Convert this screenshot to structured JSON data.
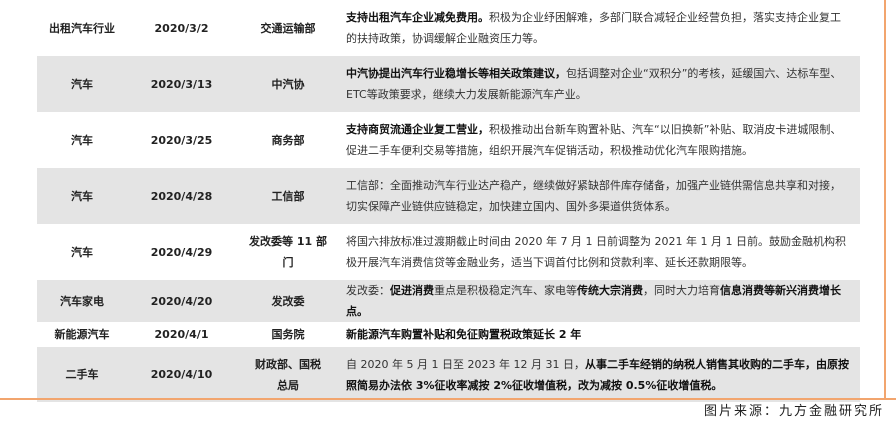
{
  "rows": [
    {
      "industry": "出租汽车行业",
      "date": "2020/3/2",
      "dept": "交通运输部",
      "bold": "支持出租汽车企业减免费用。",
      "rest": "积极为企业纾困解难，多部门联合减轻企业经营负担，落实支持企业复工的扶持政策，协调缓解企业融资压力等。"
    },
    {
      "industry": "汽车",
      "date": "2020/3/13",
      "dept": "中汽协",
      "bold": "中汽协提出汽车行业稳增长等相关政策建议，",
      "rest": "包括调整对企业“双积分”的考核，延缓国六、达标车型、ETC等政策要求，继续大力发展新能源汽车产业。"
    },
    {
      "industry": "汽车",
      "date": "2020/3/25",
      "dept": "商务部",
      "bold": "支持商贸流通企业复工营业，",
      "rest": "积极推动出台新车购置补贴、汽车“以旧换新”补贴、取消皮卡进城限制、促进二手车便利交易等措施，组织开展汽车促销活动，积极推动优化汽车限购措施。"
    },
    {
      "industry": "汽车",
      "date": "2020/4/28",
      "dept": "工信部",
      "bold": "",
      "rest": "工信部：全面推动汽车行业达产稳产，继续做好紧缺部件库存储备，加强产业链供需信息共享和对接，切实保障产业链供应链稳定，加快建立国内、国外多渠道供货体系。"
    },
    {
      "industry": "汽车",
      "date": "2020/4/29",
      "dept": "发改委等 11 部门",
      "bold": "",
      "rest": "将国六排放标准过渡期截止时间由 2020 年 7 月 1 日前调整为 2021 年 1 月 1 日前。鼓励金融机构积极开展汽车消费信贷等金融业务，适当下调首付比例和贷款利率、延长还款期限等。"
    },
    {
      "industry": "汽车家电",
      "date": "2020/4/20",
      "dept": "发改委",
      "p1": "发改委：",
      "b1": "促进消费",
      "p2": "重点是积极稳定汽车、家电等",
      "b2": "传统大宗消费",
      "p3": "，同时大力培育",
      "b3": "信息消费等新兴消费增长点。"
    },
    {
      "industry": "新能源汽车",
      "date": "2020/4/1",
      "dept": "国务院",
      "bold": "新能源汽车购置补贴和免征购置税政策延长 2 年",
      "rest": ""
    },
    {
      "industry": "二手车",
      "date": "2020/4/10",
      "dept": "财政部、国税总局",
      "pre": "自 2020 年 5 月 1 日至 2023 年 12 月 31 日，",
      "bold2": "从事二手车经销的纳税人销售其收购的二手车，由原按照简易办法依 3%征收率减按 2%征收增值税，改为减按 0.5%征收增值税。"
    }
  ],
  "source": "图片来源：九方金融研究所",
  "colors": {
    "accent": "#f2a56e",
    "shade": "#e4e4e4"
  }
}
